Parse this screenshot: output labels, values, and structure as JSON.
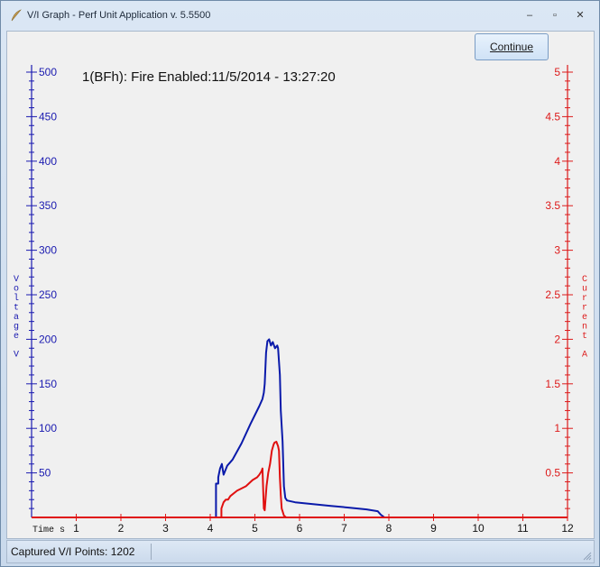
{
  "window": {
    "title": "V/I Graph - Perf Unit Application v. 5.5500",
    "controls": {
      "minimize": "–",
      "restore": "▫",
      "close": "✕"
    }
  },
  "toolbar": {
    "continue_label": "Continue"
  },
  "status": {
    "text": "Captured V/I Points: 1202"
  },
  "chart_data": {
    "type": "line",
    "title": "1(BFh): Fire Enabled:11/5/2014 - 13:27:20",
    "xlabel": "Time s",
    "ylabel_left": "Voltage V",
    "ylabel_right": "Current A",
    "xlim": [
      0,
      12
    ],
    "ylim_left": [
      0,
      500
    ],
    "ylim_right": [
      0,
      5
    ],
    "x_ticks": [
      "1",
      "2",
      "3",
      "4",
      "5",
      "6",
      "7",
      "8",
      "9",
      "10",
      "11",
      "12"
    ],
    "y_left_ticks": [
      "50",
      "100",
      "150",
      "200",
      "250",
      "300",
      "350",
      "400",
      "450",
      "500"
    ],
    "y_right_ticks": [
      "0.5",
      "1",
      "1.5",
      "2",
      "2.5",
      "3",
      "3.5",
      "4",
      "4.5",
      "5"
    ],
    "grid": false,
    "colors": {
      "voltage": "#0a1aaa",
      "current": "#e01010",
      "axis_left": "#1a1ab0",
      "axis_right": "#dd1a1a"
    },
    "series": [
      {
        "name": "Voltage V",
        "axis": "left",
        "x": [
          0,
          4.13,
          4.13,
          4.18,
          4.18,
          4.22,
          4.26,
          4.3,
          4.38,
          4.5,
          4.7,
          4.9,
          5.1,
          5.17,
          5.2,
          5.22,
          5.25,
          5.28,
          5.32,
          5.36,
          5.4,
          5.45,
          5.5,
          5.52,
          5.56,
          5.58,
          5.62,
          5.65,
          5.68,
          5.72,
          5.9,
          6.3,
          6.7,
          7.1,
          7.5,
          7.75,
          7.82,
          7.9,
          12
        ],
        "y": [
          0,
          0,
          38,
          38,
          45,
          55,
          60,
          48,
          58,
          65,
          83,
          105,
          125,
          133,
          140,
          150,
          185,
          198,
          200,
          193,
          197,
          190,
          193,
          190,
          160,
          120,
          85,
          35,
          22,
          19,
          17,
          15,
          13,
          11,
          9,
          7,
          3,
          0,
          0
        ]
      },
      {
        "name": "Current A",
        "axis": "right",
        "x": [
          0,
          4.25,
          4.25,
          4.3,
          4.35,
          4.4,
          4.45,
          4.6,
          4.8,
          4.95,
          5.05,
          5.1,
          5.15,
          5.17,
          5.2,
          5.22,
          5.26,
          5.3,
          5.34,
          5.38,
          5.42,
          5.44,
          5.48,
          5.52,
          5.54,
          5.56,
          5.58,
          5.6,
          5.65,
          5.7,
          12
        ],
        "y": [
          0,
          0,
          0.1,
          0.17,
          0.2,
          0.2,
          0.24,
          0.3,
          0.35,
          0.42,
          0.45,
          0.48,
          0.52,
          0.55,
          0.1,
          0.08,
          0.35,
          0.5,
          0.6,
          0.75,
          0.82,
          0.84,
          0.85,
          0.8,
          0.75,
          0.45,
          0.25,
          0.1,
          0.02,
          0,
          0
        ]
      }
    ]
  }
}
